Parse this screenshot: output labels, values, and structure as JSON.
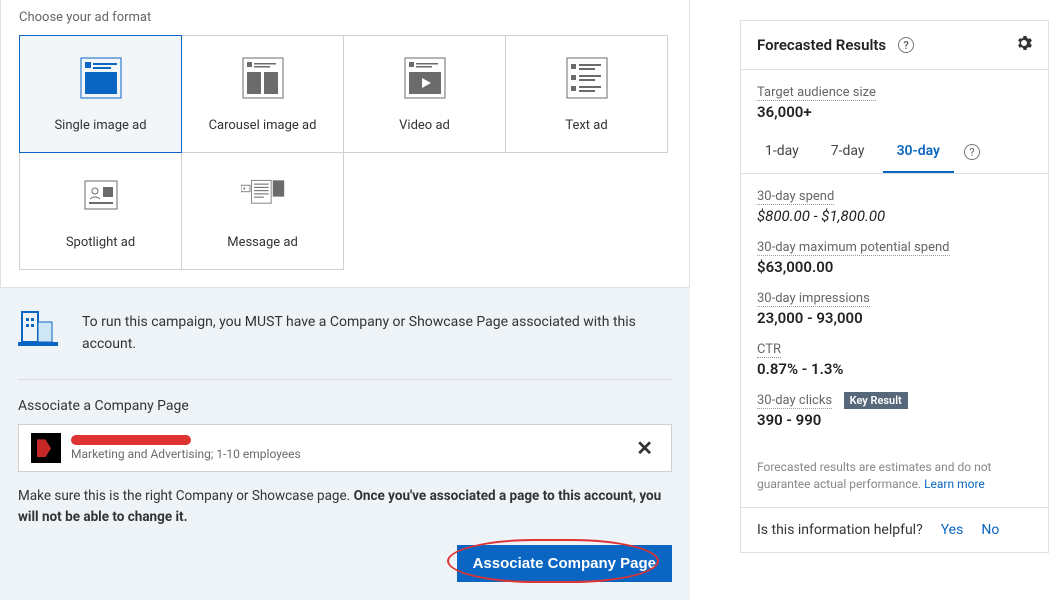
{
  "adFormat": {
    "sectionLabel": "Choose your ad format",
    "options": [
      {
        "id": "single-image",
        "label": "Single image ad",
        "selected": true
      },
      {
        "id": "carousel",
        "label": "Carousel image ad",
        "selected": false
      },
      {
        "id": "video",
        "label": "Video ad",
        "selected": false
      },
      {
        "id": "text",
        "label": "Text ad",
        "selected": false
      },
      {
        "id": "spotlight",
        "label": "Spotlight ad",
        "selected": false
      },
      {
        "id": "message",
        "label": "Message ad",
        "selected": false
      }
    ]
  },
  "notice": {
    "text": "To run this campaign, you MUST have a Company or Showcase Page associated with this account."
  },
  "associate": {
    "label": "Associate a Company Page",
    "companySub": "Marketing and Advertising; 1-10 employees",
    "confirmPrefix": "Make sure this is the right Company or Showcase page. ",
    "confirmBold": "Once you've associated a page to this account, you will not be able to change it.",
    "buttonLabel": "Associate Company Page"
  },
  "forecast": {
    "title": "Forecasted Results",
    "audience": {
      "label": "Target audience size",
      "value": "36,000+"
    },
    "tabs": [
      {
        "id": "1-day",
        "label": "1-day",
        "active": false
      },
      {
        "id": "7-day",
        "label": "7-day",
        "active": false
      },
      {
        "id": "30-day",
        "label": "30-day",
        "active": true
      }
    ],
    "metrics": [
      {
        "label": "30-day spend",
        "value": "$800.00 - $1,800.00",
        "italic": true
      },
      {
        "label": "30-day maximum potential spend",
        "value": "$63,000.00"
      },
      {
        "label": "30-day impressions",
        "value": "23,000 - 93,000"
      },
      {
        "label": "CTR",
        "value": "0.87% - 1.3%"
      },
      {
        "label": "30-day clicks",
        "value": "390 - 990",
        "keyResult": true
      }
    ],
    "keyResultBadge": "Key Result",
    "disclaimer": "Forecasted results are estimates and do not guarantee actual performance.",
    "learnMore": "Learn more",
    "helpful": {
      "question": "Is this information helpful?",
      "yes": "Yes",
      "no": "No"
    }
  }
}
